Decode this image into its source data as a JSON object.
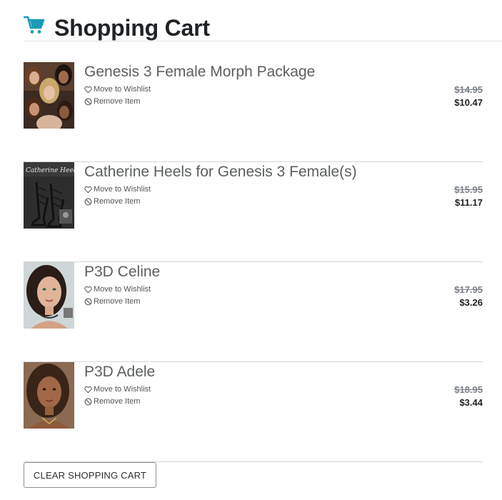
{
  "header": {
    "title": "Shopping Cart",
    "icon": "shopping-cart-icon",
    "accent_color": "#1a9ab5"
  },
  "cart": {
    "move_label": "Move to Wishlist",
    "remove_label": "Remove Item",
    "items": [
      {
        "title": "Genesis 3 Female Morph Package",
        "old_price": "$14.95",
        "price": "$10.47"
      },
      {
        "title": "Catherine Heels for Genesis 3 Female(s)",
        "old_price": "$15.95",
        "price": "$11.17",
        "thumb_text": "Catherine Heels"
      },
      {
        "title": "P3D Celine",
        "old_price": "$17.95",
        "price": "$3.26"
      },
      {
        "title": "P3D Adele",
        "old_price": "$18.95",
        "price": "$3.44"
      }
    ]
  },
  "footer": {
    "clear_label": "CLEAR SHOPPING CART"
  }
}
